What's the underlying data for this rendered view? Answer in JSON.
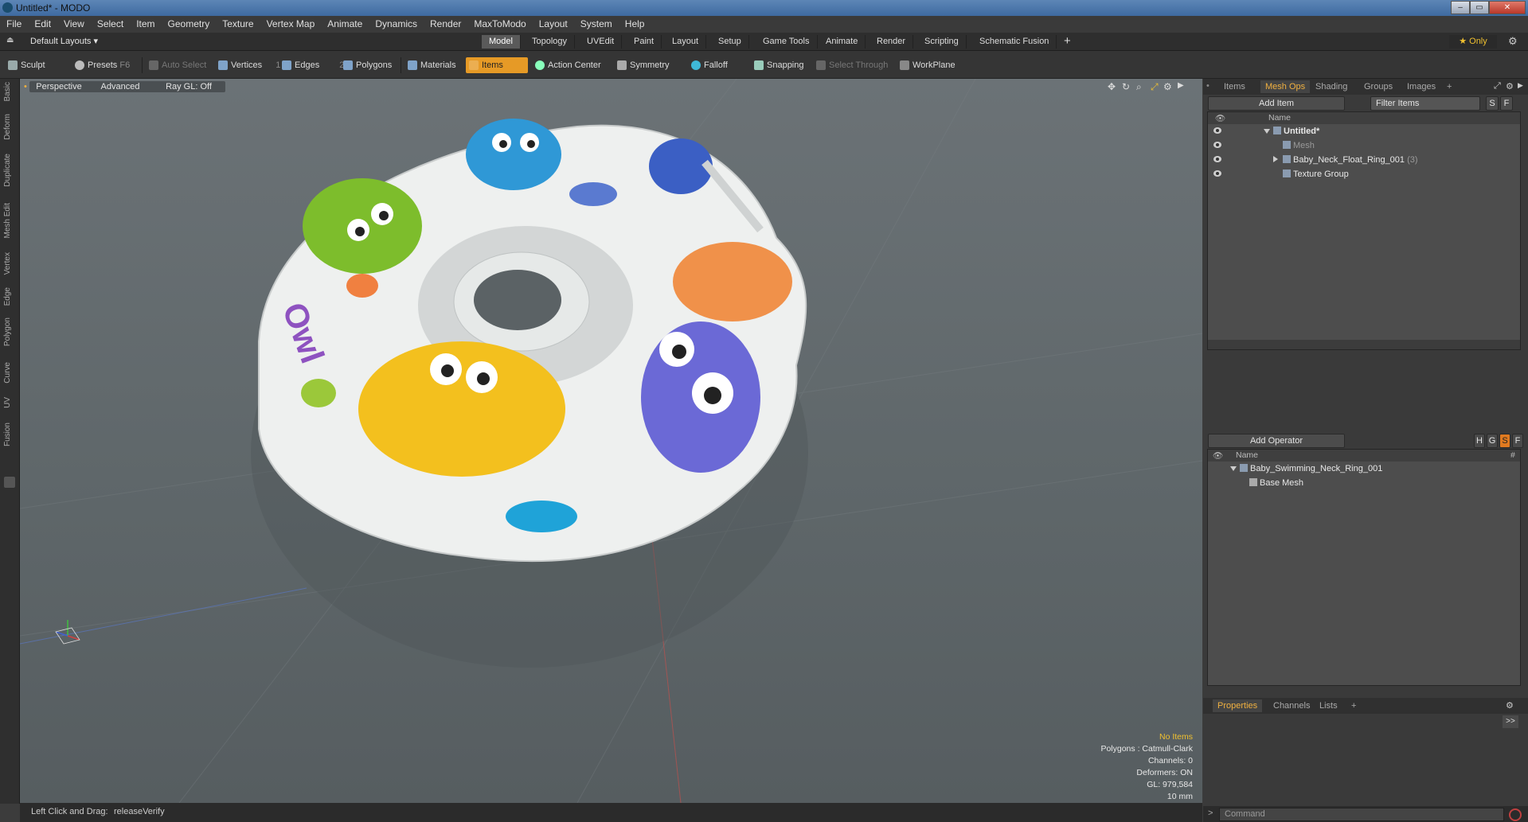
{
  "window": {
    "title": "Untitled* - MODO",
    "buttons": [
      "–",
      "▭",
      "✕"
    ]
  },
  "menu": [
    "File",
    "Edit",
    "View",
    "Select",
    "Item",
    "Geometry",
    "Texture",
    "Vertex Map",
    "Animate",
    "Dynamics",
    "Render",
    "MaxToModo",
    "Layout",
    "System",
    "Help"
  ],
  "layouts": {
    "label": "Default Layouts ▾"
  },
  "mode_tabs": [
    "Model",
    "Topology",
    "UVEdit",
    "Paint",
    "Layout",
    "Setup",
    "Game Tools",
    "Animate",
    "Render",
    "Scripting",
    "Schematic Fusion"
  ],
  "active_mode_tab": "Model",
  "add_tab": "+",
  "only_label": "★ Only",
  "toolbar": {
    "sculpt": "Sculpt",
    "presets": "Presets",
    "presets_key": "F6",
    "auto_select": "Auto Select",
    "vertices": "Vertices",
    "vertices_count": "1",
    "edges": "Edges",
    "edges_count": "2",
    "polygons": "Polygons",
    "materials": "Materials",
    "items": "Items",
    "action_center": "Action Center",
    "symmetry": "Symmetry",
    "falloff": "Falloff",
    "snapping": "Snapping",
    "select_through": "Select Through",
    "workplane": "WorkPlane"
  },
  "left_tabs": [
    "Basic",
    "Deform",
    "Duplicate",
    "Mesh Edit",
    "Vertex",
    "Edge",
    "Polygon",
    "Curve",
    "UV",
    "Fusion"
  ],
  "viewport": {
    "view": "Perspective",
    "advanced": "Advanced",
    "raygl": "Ray GL: Off",
    "stats": {
      "selection": "No Items",
      "polygons": "Polygons : Catmull-Clark",
      "channels": "Channels: 0",
      "deformers": "Deformers: ON",
      "gl": "GL: 979,584",
      "scale": "10 mm"
    }
  },
  "status": {
    "hint": "Left Click and Drag:",
    "action": "releaseVerify"
  },
  "scene_panel": {
    "tabs": [
      "Items",
      "Mesh Ops",
      "Shading",
      "Groups",
      "Images",
      "+"
    ],
    "active_tab": "Mesh Ops",
    "add_item": "Add Item",
    "filter": "Filter Items",
    "s_btn": "S",
    "f_btn": "F",
    "col_name": "Name",
    "items": [
      {
        "label": "Untitled*",
        "bold": true
      },
      {
        "label": "Mesh",
        "dim": true
      },
      {
        "label": "Baby_Neck_Float_Ring_001",
        "suffix": "(3)"
      },
      {
        "label": "Texture Group"
      }
    ]
  },
  "meshops_panel": {
    "add_operator": "Add Operator",
    "hgsf": [
      "H",
      "G",
      "S",
      "F"
    ],
    "col_name": "Name",
    "col_hash": "#",
    "items": [
      {
        "label": "Baby_Swimming_Neck_Ring_001"
      },
      {
        "label": "Base Mesh"
      }
    ]
  },
  "bottom_tabs": {
    "tabs": [
      "Properties",
      "Channels",
      "Lists",
      "+"
    ],
    "active": "Properties"
  },
  "command": {
    "placeholder": "Command"
  }
}
